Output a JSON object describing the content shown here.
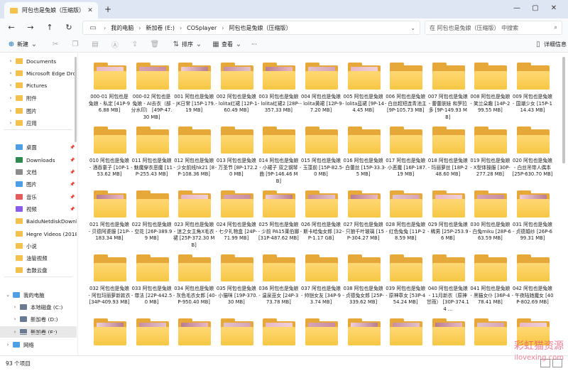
{
  "window": {
    "tab_title": "阿包也是兔娘（压缩版）",
    "tab_close": "✕",
    "new_tab": "+",
    "minimize": "—",
    "maximize": "▢",
    "close": "✕"
  },
  "nav": {
    "back": "←",
    "forward": "→",
    "up": "↑",
    "refresh": "↻"
  },
  "breadcrumb": [
    "我的电脑",
    "新加卷 (E:)",
    "COSplayer",
    "阿包也是兔娘（压缩版）"
  ],
  "search": {
    "placeholder": "在 阿包也是兔娘（压缩版） 中搜索"
  },
  "toolbar": {
    "new": "新建",
    "sort": "排序",
    "view": "查看",
    "more": "···",
    "details": "详细信息"
  },
  "sidebar": [
    {
      "label": "Documents",
      "chevron": "›"
    },
    {
      "label": "Microsoft Edge Drop",
      "chevron": "›"
    },
    {
      "label": "Pictures",
      "chevron": "›"
    },
    {
      "label": "附件",
      "chevron": "›"
    },
    {
      "label": "图片",
      "chevron": "›"
    },
    {
      "label": "应用",
      "chevron": "›"
    },
    {
      "label": "桌面",
      "chevron": ""
    },
    {
      "label": "Downloads",
      "chevron": ""
    },
    {
      "label": "文档",
      "chevron": ""
    },
    {
      "label": "图片",
      "chevron": ""
    },
    {
      "label": "音乐",
      "chevron": ""
    },
    {
      "label": "视频",
      "chevron": ""
    },
    {
      "label": "BaiduNetdiskDownl",
      "chevron": ""
    },
    {
      "label": "Hegre Videos (2018)",
      "chevron": ""
    },
    {
      "label": "小说",
      "chevron": ""
    },
    {
      "label": "油管视频",
      "chevron": ""
    },
    {
      "label": "击鼓云盘",
      "chevron": ""
    },
    {
      "label": "我的电脑",
      "chevron": "⌄"
    },
    {
      "label": "本地磁盘 (C:)",
      "chevron": "›"
    },
    {
      "label": "新加卷 (D:)",
      "chevron": "›"
    },
    {
      "label": "新加卷 (E:)",
      "chevron": "›"
    },
    {
      "label": "网络",
      "chevron": "›"
    }
  ],
  "items": [
    {
      "name": "000-01 阿包也是兔娘 - 私定 [41P-96.88 MB]",
      "preview": true
    },
    {
      "name": "000-02 阿包也是兔娘 - AI去衣（部分水印） [49P-47.30 MB]",
      "preview": true
    },
    {
      "name": "001 阿包也是兔娘 - JK日常 [15P-179.19 MB]",
      "preview": true
    },
    {
      "name": "002 阿包也是兔娘 - lolita红裙 [12P-160.49 MB]",
      "preview": true
    },
    {
      "name": "003 阿包也是兔娘 - lolita红裙2 [28P-357.33 MB]",
      "preview": true
    },
    {
      "name": "004 阿包也是兔娘 - lolita黄裙 [12P-97.20 MB]",
      "preview": true
    },
    {
      "name": "005 阿包也是兔娘 - lolita蓝裙 [9P-144.45 MB]",
      "preview": true
    },
    {
      "name": "006 阿包也是兔娘 - 白丝超短连青池主 [9P-105.73 MB]",
      "preview": false
    },
    {
      "name": "007 阿包也是兔娘 - 蕾蕾肤娃 和罗拉多 [9P-149.93 MB]",
      "preview": false
    },
    {
      "name": "008 阿包也是兔娘 - 笑兰朵趣 [14P-299.55 MB]",
      "preview": false
    },
    {
      "name": "009 阿包也是兔娘 - 国潮少女 [15P-114.43 MB]",
      "preview": false
    },
    {
      "name": "010 阿包也是兔娘 - 酒吞童子 [10P-153.62 MB]",
      "preview": false
    },
    {
      "name": "011 阿包也是兔娘 - 魅魔穿衣恶魔 [11P-255.43 MB]",
      "preview": false
    },
    {
      "name": "012 阿包也是兔娘 - 少女前线hk21 [8P-108.36 MB]",
      "preview": false
    },
    {
      "name": "013 阿包也是兔娘 - 万圣节 [8P-172.20 MB]",
      "preview": false
    },
    {
      "name": "014 阿包也是兔娘 - 小裙子 双之钢琴曲 [9P-146.46 MB]",
      "preview": false
    },
    {
      "name": "015 阿包也是兔娘 - 玉藻前 [15P-82.50 MB]",
      "preview": false
    },
    {
      "name": "016 阿包也是兔娘 - 白蕾丝 [15P-33.35 MB]",
      "preview": false
    },
    {
      "name": "017 阿包也是兔娘 - 小恶魔 [16P-187.19 MB]",
      "preview": false
    },
    {
      "name": "018 阿包也是兔娘 - 玛丽萝丝 [18P-248.60 MB]",
      "preview": false
    },
    {
      "name": "019 阿包也是兔娘 - X型体操服 [30P-277.28 MB]",
      "preview": false
    },
    {
      "name": "020 阿包也是兔娘 - 白丝吊带人偶本 [25P-630.70 MB]",
      "preview": false
    },
    {
      "name": "021 阿包也是兔娘 - 贝德阿婆服 [21P-183.34 MB]",
      "preview": true
    },
    {
      "name": "022 阿包也是兔娘 - 空花 [26P-389.99 MB]",
      "preview": false
    },
    {
      "name": "023 阿包也是兔娘 - 迷之女主角X毛衣裙 [25P-372.30 MB]",
      "preview": true
    },
    {
      "name": "024 阿包也是兔娘 - 七夕礼物盒 [24P-71.99 MB]",
      "preview": true
    },
    {
      "name": "025 阿包也是兔娘 - 少前 PA15莱伯娜 [31P-487.62 MB]",
      "preview": true
    },
    {
      "name": "026 阿包也是兔娘 - 斯卡哈兔女郎 [32P-1.17 GB]",
      "preview": true
    },
    {
      "name": "027 阿包也是兔娘 - 只狼千叶玻璃 [15P-304.27 MB]",
      "preview": true
    },
    {
      "name": "028 阿包也是兔娘 - 红色兔兔 [11P-28.59 MB]",
      "preview": true
    },
    {
      "name": "029 阿包也是兔娘 - 稀男 [25P-253.96 MB]",
      "preview": true
    },
    {
      "name": "030 阿包也是兔娘 - 白兔miku [28P-663.59 MB]",
      "preview": true
    },
    {
      "name": "031 阿包也是兔娘 - 贞德婚纱 [26P-699.31 MB]",
      "preview": true
    },
    {
      "name": "032 阿包也是兔娘 - 阿包玛丽萝新款衣 [34P-409.93 MB]",
      "preview": false
    },
    {
      "name": "033 阿包也是兔娘 - 尊法 [22P-442.50 MB]",
      "preview": false
    },
    {
      "name": "034 阿包也是兔娘 - 灰色毛衣女郎 [40P-950.40 MB]",
      "preview": false
    },
    {
      "name": "035 阿包也是兔娘 - 小猫咪 [19P-370.30 MB]",
      "preview": false
    },
    {
      "name": "036 阿包也是兔娘 - 温泉巫女 [24P-373.78 MB]",
      "preview": false
    },
    {
      "name": "037 阿包也是兔娘 - 帅铠女友 [34P-93.74 MB]",
      "preview": false
    },
    {
      "name": "038 阿包也是兔娘 - 贞德兔女郎 [25P-339.62 MB]",
      "preview": false
    },
    {
      "name": "039 阿包也是兔娘 - 原神章女 [53P-454.24 MB]",
      "preview": false
    },
    {
      "name": "040 阿包也是兔娘 - 11月新衣（原神甘雨） [30P-374.14 ...",
      "preview": false
    },
    {
      "name": "041 阿包也是兔娘 - 黑猫女仆 [36P-478.41 MB]",
      "preview": false
    },
    {
      "name": "042 阿包也是兔娘 - 午夜陆她魔女 [40P-802.69 MB]",
      "preview": false
    },
    {
      "name": "",
      "preview": true
    },
    {
      "name": "",
      "preview": true
    },
    {
      "name": "",
      "preview": true
    },
    {
      "name": "",
      "preview": true
    },
    {
      "name": "",
      "preview": true
    },
    {
      "name": "",
      "preview": true
    },
    {
      "name": "",
      "preview": true
    },
    {
      "name": "",
      "preview": true
    },
    {
      "name": "",
      "preview": true
    },
    {
      "name": "",
      "preview": true
    },
    {
      "name": "",
      "preview": true
    }
  ],
  "status": {
    "count": "93 个项目"
  },
  "watermark": {
    "line1": "彩虹猫资源",
    "line2": "ilovexing.com"
  },
  "colors": {
    "folder_front": "#f6c744",
    "folder_back": "#e7a83a",
    "titlebar": "#dfe6f3",
    "watermark": "#e34b6a"
  }
}
